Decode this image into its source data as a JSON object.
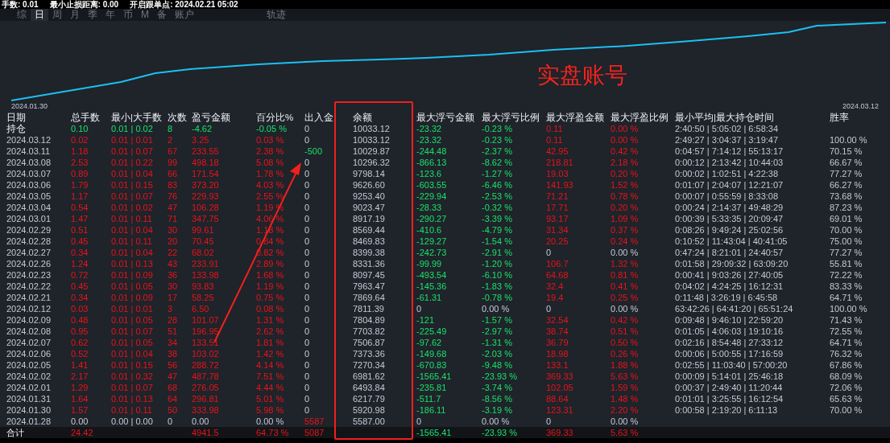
{
  "info_bar": [
    {
      "label": "手数:",
      "value": "0.01"
    },
    {
      "label": "最小止损距离:",
      "value": "0.00"
    },
    {
      "label": "开启跟单点:",
      "value": "2024.02.21 05:02"
    }
  ],
  "tabs": [
    {
      "label": "综",
      "kind": "period",
      "selected": false
    },
    {
      "label": "日",
      "kind": "period",
      "selected": true
    },
    {
      "label": "周",
      "kind": "period",
      "selected": false
    },
    {
      "label": "月",
      "kind": "period",
      "selected": false
    },
    {
      "label": "季",
      "kind": "period",
      "selected": false
    },
    {
      "label": "年",
      "kind": "period",
      "selected": false
    },
    {
      "label": "币",
      "kind": "period",
      "selected": false
    },
    {
      "label": "M",
      "kind": "period",
      "selected": false
    },
    {
      "label": "备",
      "kind": "period",
      "selected": false
    },
    {
      "label": "账户",
      "kind": "period",
      "selected": false
    },
    {
      "label": "轨迹",
      "kind": "view",
      "selected": false
    }
  ],
  "chart": {
    "start_label": "2024.01.30",
    "end_label": "2024.03.12"
  },
  "annotation": {
    "label": "实盘账号"
  },
  "columns": [
    "日期",
    "总手数",
    "最小|大手数",
    "次数",
    "盈亏金额",
    "百分比%",
    "出入金",
    "余额",
    "最大浮亏金额",
    "最大浮亏比例",
    "最大浮盈金额",
    "最大浮盈比例",
    "最小平均|最大持仓时间",
    "胜率"
  ],
  "rows": [
    {
      "kind": "holding",
      "withdrawal": false,
      "deposit": false,
      "float_loss_on": true,
      "float_profit_on": true,
      "cells": [
        "持仓",
        "0.10",
        "0.01 | 0.02",
        "8",
        "-4.62",
        "-0.05 %",
        "0",
        "10033.12",
        "-23.32",
        "-0.23 %",
        "0.11",
        "0.00 %",
        "2:40:50 | 5:05:02 | 6:58:34"
      ]
    },
    {
      "kind": "profit",
      "withdrawal": false,
      "deposit": false,
      "float_loss_on": true,
      "float_profit_on": true,
      "cells": [
        "2024.03.12",
        "0.02",
        "0.01 | 0.01",
        "2",
        "3.25",
        "0.03 %",
        "0",
        "10033.12",
        "-23.32",
        "-0.23 %",
        "0.11",
        "0.00 %",
        "2:49:27 | 3:04:37 | 3:19:47",
        "100.00 %"
      ]
    },
    {
      "kind": "profit",
      "withdrawal": true,
      "deposit": false,
      "float_loss_on": true,
      "float_profit_on": true,
      "cells": [
        "2024.03.11",
        "1.18",
        "0.01 | 0.07",
        "67",
        "233.55",
        "2.38 %",
        "-500",
        "10029.87",
        "-244.48",
        "-2.37 %",
        "42.95",
        "0.42 %",
        "0:04:57 | 7:14:12 | 55:13:17",
        "70.15 %"
      ]
    },
    {
      "kind": "profit",
      "withdrawal": false,
      "deposit": false,
      "float_loss_on": true,
      "float_profit_on": true,
      "cells": [
        "2024.03.08",
        "2.53",
        "0.01 | 0.22",
        "99",
        "498.18",
        "5.08 %",
        "0",
        "10296.32",
        "-866.13",
        "-8.62 %",
        "218.81",
        "2.18 %",
        "0:00:12 | 2:13:42 | 10:44:03",
        "66.67 %"
      ]
    },
    {
      "kind": "profit",
      "withdrawal": false,
      "deposit": false,
      "float_loss_on": true,
      "float_profit_on": true,
      "cells": [
        "2024.03.07",
        "0.89",
        "0.01 | 0.04",
        "66",
        "171.54",
        "1.78 %",
        "0",
        "9798.14",
        "-123.6",
        "-1.27 %",
        "19.03",
        "0.20 %",
        "0:00:02 | 1:02:51 | 4:22:38",
        "77.27 %"
      ]
    },
    {
      "kind": "profit",
      "withdrawal": false,
      "deposit": false,
      "float_loss_on": true,
      "float_profit_on": true,
      "cells": [
        "2024.03.06",
        "1.79",
        "0.01 | 0.15",
        "83",
        "373.20",
        "4.03 %",
        "0",
        "9626.60",
        "-603.55",
        "-6.46 %",
        "141.93",
        "1.52 %",
        "0:01:07 | 2:04:07 | 12:21:07",
        "66.27 %"
      ]
    },
    {
      "kind": "profit",
      "withdrawal": false,
      "deposit": false,
      "float_loss_on": true,
      "float_profit_on": true,
      "cells": [
        "2024.03.05",
        "1.17",
        "0.01 | 0.07",
        "76",
        "229.93",
        "2.55 %",
        "0",
        "9253.40",
        "-229.94",
        "-2.53 %",
        "71.21",
        "0.78 %",
        "0:00:07 | 0:55:59 | 8:33:08",
        "73.68 %"
      ]
    },
    {
      "kind": "profit",
      "withdrawal": false,
      "deposit": false,
      "float_loss_on": true,
      "float_profit_on": true,
      "cells": [
        "2024.03.04",
        "0.54",
        "0.01 | 0.02",
        "47",
        "106.28",
        "1.19 %",
        "0",
        "9023.47",
        "-28.33",
        "-0.32 %",
        "17.71",
        "0.20 %",
        "0:00:24 | 2:14:37 | 49:48:29",
        "87.23 %"
      ]
    },
    {
      "kind": "profit",
      "withdrawal": false,
      "deposit": false,
      "float_loss_on": true,
      "float_profit_on": true,
      "cells": [
        "2024.03.01",
        "1.47",
        "0.01 | 0.11",
        "71",
        "347.75",
        "4.06 %",
        "0",
        "8917.19",
        "-290.27",
        "-3.39 %",
        "93.17",
        "1.09 %",
        "0:00:39 | 5:33:35 | 20:09:47",
        "69.01 %"
      ]
    },
    {
      "kind": "profit",
      "withdrawal": false,
      "deposit": false,
      "float_loss_on": true,
      "float_profit_on": true,
      "cells": [
        "2024.02.29",
        "0.51",
        "0.01 | 0.04",
        "30",
        "99.61",
        "1.18 %",
        "0",
        "8569.44",
        "-410.6",
        "-4.79 %",
        "31.34",
        "0.37 %",
        "0:08:26 | 9:49:24 | 25:02:56",
        "70.00 %"
      ]
    },
    {
      "kind": "profit",
      "withdrawal": false,
      "deposit": false,
      "float_loss_on": true,
      "float_profit_on": true,
      "cells": [
        "2024.02.28",
        "0.45",
        "0.01 | 0.11",
        "20",
        "70.45",
        "0.84 %",
        "0",
        "8469.83",
        "-129.27",
        "-1.54 %",
        "20.25",
        "0.24 %",
        "0:10:52 | 11:43:04 | 40:41:05",
        "75.00 %"
      ]
    },
    {
      "kind": "profit",
      "withdrawal": false,
      "deposit": false,
      "float_loss_on": true,
      "float_profit_on": false,
      "cells": [
        "2024.02.27",
        "0.34",
        "0.01 | 0.04",
        "22",
        "68.02",
        "0.82 %",
        "0",
        "8399.38",
        "-242.73",
        "-2.91 %",
        "0",
        "0.00 %",
        "0:47:24 | 8:21:01 | 24:40:57",
        "77.27 %"
      ]
    },
    {
      "kind": "profit",
      "withdrawal": false,
      "deposit": false,
      "float_loss_on": true,
      "float_profit_on": true,
      "cells": [
        "2024.02.26",
        "1.24",
        "0.01 | 0.13",
        "43",
        "233.91",
        "2.89 %",
        "0",
        "8331.36",
        "-99.99",
        "-1.20 %",
        "106.7",
        "1.32 %",
        "0:01:58 | 29:09:32 | 63:09:20",
        "55.81 %"
      ]
    },
    {
      "kind": "profit",
      "withdrawal": false,
      "deposit": false,
      "float_loss_on": true,
      "float_profit_on": true,
      "cells": [
        "2024.02.23",
        "0.72",
        "0.01 | 0.09",
        "36",
        "133.98",
        "1.68 %",
        "0",
        "8097.45",
        "-493.54",
        "-6.10 %",
        "64.68",
        "0.81 %",
        "0:00:41 | 9:03:26 | 27:40:05",
        "72.22 %"
      ]
    },
    {
      "kind": "profit",
      "withdrawal": false,
      "deposit": false,
      "float_loss_on": true,
      "float_profit_on": true,
      "cells": [
        "2024.02.22",
        "0.45",
        "0.01 | 0.05",
        "30",
        "93.83",
        "1.19 %",
        "0",
        "7963.47",
        "-145.36",
        "-1.83 %",
        "32.4",
        "0.41 %",
        "0:04:02 | 4:24:25 | 16:12:31",
        "83.33 %"
      ]
    },
    {
      "kind": "profit",
      "withdrawal": false,
      "deposit": false,
      "float_loss_on": true,
      "float_profit_on": true,
      "cells": [
        "2024.02.21",
        "0.34",
        "0.01 | 0.09",
        "17",
        "58.25",
        "0.75 %",
        "0",
        "7869.64",
        "-61.31",
        "-0.78 %",
        "19.4",
        "0.25 %",
        "0:11:48 | 3:26:19 | 6:45:58",
        "64.71 %"
      ]
    },
    {
      "kind": "profit",
      "withdrawal": false,
      "deposit": false,
      "float_loss_on": false,
      "float_profit_on": false,
      "cells": [
        "2024.02.12",
        "0.03",
        "0.01 | 0.01",
        "3",
        "6.50",
        "0.08 %",
        "0",
        "7811.39",
        "0",
        "0.00 %",
        "0",
        "0.00 %",
        "63:42:26 | 64:41:20 | 65:51:24",
        "100.00 %"
      ]
    },
    {
      "kind": "profit",
      "withdrawal": false,
      "deposit": false,
      "float_loss_on": true,
      "float_profit_on": true,
      "cells": [
        "2024.02.09",
        "0.48",
        "0.01 | 0.05",
        "28",
        "101.07",
        "1.31 %",
        "0",
        "7804.89",
        "-121",
        "-1.57 %",
        "32.54",
        "0.42 %",
        "0:09:48 | 9:46:10 | 22:59:20",
        "71.43 %"
      ]
    },
    {
      "kind": "profit",
      "withdrawal": false,
      "deposit": false,
      "float_loss_on": true,
      "float_profit_on": true,
      "cells": [
        "2024.02.08",
        "0.95",
        "0.01 | 0.07",
        "51",
        "196.95",
        "2.62 %",
        "0",
        "7703.82",
        "-225.49",
        "-2.97 %",
        "38.74",
        "0.51 %",
        "0:01:05 | 4:06:03 | 19:10:16",
        "72.55 %"
      ]
    },
    {
      "kind": "profit",
      "withdrawal": false,
      "deposit": false,
      "float_loss_on": true,
      "float_profit_on": true,
      "cells": [
        "2024.02.07",
        "0.62",
        "0.01 | 0.05",
        "34",
        "133.51",
        "1.81 %",
        "0",
        "7506.87",
        "-97.62",
        "-1.31 %",
        "36.79",
        "0.50 %",
        "0:02:16 | 8:54:48 | 27:33:12",
        "64.71 %"
      ]
    },
    {
      "kind": "profit",
      "withdrawal": false,
      "deposit": false,
      "float_loss_on": true,
      "float_profit_on": true,
      "cells": [
        "2024.02.06",
        "0.52",
        "0.01 | 0.04",
        "38",
        "103.02",
        "1.42 %",
        "0",
        "7373.36",
        "-149.68",
        "-2.03 %",
        "18.98",
        "0.26 %",
        "0:00:06 | 5:00:55 | 17:16:59",
        "76.32 %"
      ]
    },
    {
      "kind": "profit",
      "withdrawal": false,
      "deposit": false,
      "float_loss_on": true,
      "float_profit_on": true,
      "cells": [
        "2024.02.05",
        "1.41",
        "0.01 | 0.15",
        "56",
        "288.72",
        "4.14 %",
        "0",
        "7270.34",
        "-670.83",
        "-9.48 %",
        "133.1",
        "1.88 %",
        "0:02:55 | 11:03:40 | 57:00:20",
        "67.86 %"
      ]
    },
    {
      "kind": "profit",
      "withdrawal": false,
      "deposit": false,
      "float_loss_on": true,
      "float_profit_on": true,
      "cells": [
        "2024.02.02",
        "2.17",
        "0.01 | 0.32",
        "47",
        "487.78",
        "7.51 %",
        "0",
        "6981.62",
        "-1565.41",
        "-23.93 %",
        "369.33",
        "5.63 %",
        "0:00:09 | 5:14:01 | 25:46:18",
        "68.09 %"
      ]
    },
    {
      "kind": "profit",
      "withdrawal": false,
      "deposit": false,
      "float_loss_on": true,
      "float_profit_on": true,
      "cells": [
        "2024.02.01",
        "1.29",
        "0.01 | 0.07",
        "68",
        "276.05",
        "4.44 %",
        "0",
        "6493.84",
        "-235.81",
        "-3.74 %",
        "102.05",
        "1.59 %",
        "0:00:37 | 2:49:40 | 11:20:44",
        "72.06 %"
      ]
    },
    {
      "kind": "profit",
      "withdrawal": false,
      "deposit": false,
      "float_loss_on": true,
      "float_profit_on": true,
      "cells": [
        "2024.01.31",
        "1.64",
        "0.01 | 0.13",
        "64",
        "296.81",
        "5.01 %",
        "0",
        "6217.79",
        "-511.7",
        "-8.56 %",
        "88.64",
        "1.48 %",
        "0:01:01 | 3:25:55 | 16:12:54",
        "65.63 %"
      ]
    },
    {
      "kind": "profit",
      "withdrawal": false,
      "deposit": false,
      "float_loss_on": true,
      "float_profit_on": true,
      "cells": [
        "2024.01.30",
        "1.57",
        "0.01 | 0.11",
        "50",
        "333.98",
        "5.98 %",
        "0",
        "5920.98",
        "-186.11",
        "-3.19 %",
        "123.31",
        "2.20 %",
        "0:00:58 | 2:19:20 | 6:11:13",
        "70.00 %"
      ]
    },
    {
      "kind": "flat",
      "withdrawal": false,
      "deposit": true,
      "float_loss_on": false,
      "float_profit_on": false,
      "cells": [
        "2024.01.28",
        "0.00",
        "0.00 | 0.00",
        "0",
        "0.00",
        "0.00 %",
        "5587",
        "5587.00",
        "0",
        "0.00 %",
        "0",
        "0.00 %"
      ]
    }
  ],
  "total": {
    "label": "合计",
    "lots": "24.42",
    "pnl": "4941.5",
    "pnl_pct": "64.73 %",
    "transfer": "5087",
    "float_loss": "-1565.41",
    "float_loss_pct": "-23.93 %",
    "float_profit": "369.33",
    "float_profit_pct": "5.63 %"
  }
}
